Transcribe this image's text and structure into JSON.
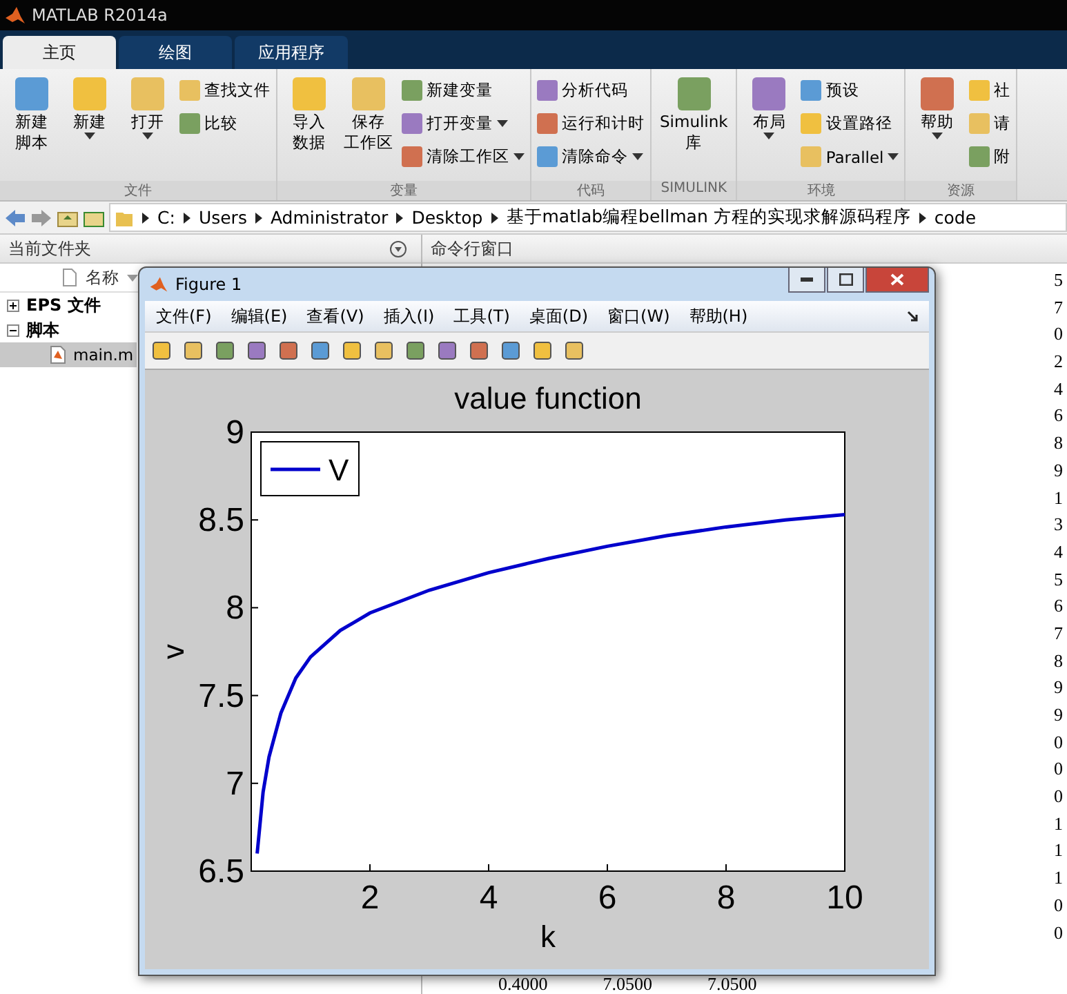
{
  "app_title": "MATLAB R2014a",
  "tabs": [
    {
      "label": "主页",
      "selected": true
    },
    {
      "label": "绘图",
      "selected": false
    },
    {
      "label": "应用程序",
      "selected": false
    }
  ],
  "ribbon": [
    {
      "group": "文件",
      "columns": [
        {
          "kind": "large",
          "lines": [
            "新建",
            "脚本"
          ],
          "dropdown": false
        },
        {
          "kind": "large",
          "lines": [
            "新建"
          ],
          "dropdown": true
        },
        {
          "kind": "large",
          "lines": [
            "打开"
          ],
          "dropdown": true
        },
        {
          "kind": "stack",
          "items": [
            {
              "label": "查找文件",
              "dropdown": false
            },
            {
              "label": "比较",
              "dropdown": false
            }
          ]
        }
      ]
    },
    {
      "group": "变量",
      "columns": [
        {
          "kind": "large",
          "lines": [
            "导入",
            "数据"
          ],
          "dropdown": false
        },
        {
          "kind": "large",
          "lines": [
            "保存",
            "工作区"
          ],
          "dropdown": false
        },
        {
          "kind": "stack",
          "items": [
            {
              "label": "新建变量",
              "dropdown": false
            },
            {
              "label": "打开变量",
              "dropdown": true
            },
            {
              "label": "清除工作区",
              "dropdown": true
            }
          ]
        }
      ]
    },
    {
      "group": "代码",
      "columns": [
        {
          "kind": "stack",
          "items": [
            {
              "label": "分析代码",
              "dropdown": false
            },
            {
              "label": "运行和计时",
              "dropdown": false
            },
            {
              "label": "清除命令",
              "dropdown": true
            }
          ]
        }
      ]
    },
    {
      "group": "SIMULINK",
      "columns": [
        {
          "kind": "large",
          "lines": [
            "Simulink",
            "库"
          ],
          "dropdown": false
        }
      ]
    },
    {
      "group": "环境",
      "columns": [
        {
          "kind": "large",
          "lines": [
            "布局"
          ],
          "dropdown": true
        },
        {
          "kind": "stack",
          "items": [
            {
              "label": "预设",
              "dropdown": false
            },
            {
              "label": "设置路径",
              "dropdown": false
            },
            {
              "label": "Parallel",
              "dropdown": true
            }
          ]
        }
      ]
    },
    {
      "group": "资源",
      "columns": [
        {
          "kind": "large",
          "lines": [
            "帮助"
          ],
          "dropdown": true
        },
        {
          "kind": "stack",
          "items": [
            {
              "label": "社",
              "dropdown": false
            },
            {
              "label": "请",
              "dropdown": false
            },
            {
              "label": "附",
              "dropdown": false
            }
          ]
        }
      ]
    }
  ],
  "path": [
    "C:",
    "Users",
    "Administrator",
    "Desktop",
    "基于matlab编程bellman 方程的实现求解源码程序",
    "code"
  ],
  "file_panel": {
    "title": "当前文件夹",
    "column": "名称",
    "tree": [
      {
        "label": "EPS 文件",
        "expanded": false
      },
      {
        "label": "脚本",
        "expanded": true,
        "children": [
          {
            "label": "main.m",
            "selected": true
          }
        ]
      }
    ]
  },
  "command_window": {
    "title": "命令行窗口",
    "edge_digits": [
      "5",
      "7",
      "0",
      "2",
      "4",
      "6",
      "8",
      "9",
      "1",
      "3",
      "4",
      "5",
      "6",
      "7",
      "8",
      "9",
      "9",
      "0",
      "0",
      "0",
      "1",
      "1",
      "1",
      "0",
      "0"
    ],
    "last_row": [
      "0.4000",
      "7.0500",
      "7.0500"
    ]
  },
  "figure": {
    "title": "Figure 1",
    "menus": [
      "文件(F)",
      "编辑(E)",
      "查看(V)",
      "插入(I)",
      "工具(T)",
      "桌面(D)",
      "窗口(W)",
      "帮助(H)"
    ],
    "chart_data": {
      "type": "line",
      "title": "value function",
      "xlabel": "k",
      "ylabel": "v",
      "xlim": [
        0,
        10
      ],
      "ylim": [
        6.5,
        9
      ],
      "xticks": [
        2,
        4,
        6,
        8,
        10
      ],
      "yticks": [
        6.5,
        7,
        7.5,
        8,
        8.5,
        9
      ],
      "x": [
        0.1,
        0.2,
        0.3,
        0.5,
        0.75,
        1,
        1.5,
        2,
        3,
        4,
        5,
        6,
        7,
        8,
        9,
        10
      ],
      "series": [
        {
          "name": "V",
          "color": "#0000cc",
          "values": [
            6.6,
            6.95,
            7.15,
            7.4,
            7.6,
            7.72,
            7.87,
            7.97,
            8.1,
            8.2,
            8.28,
            8.35,
            8.41,
            8.46,
            8.5,
            8.53
          ]
        }
      ]
    }
  }
}
